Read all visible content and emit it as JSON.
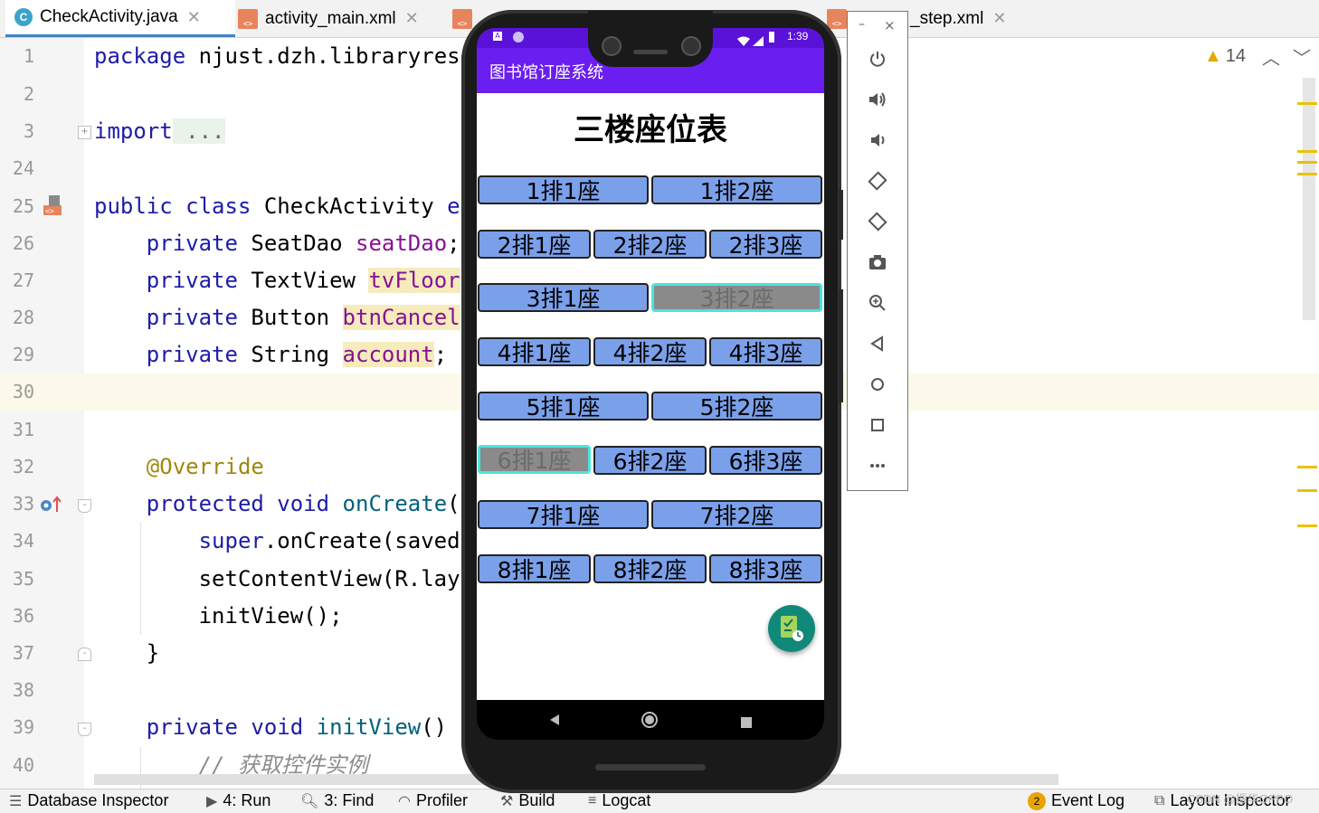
{
  "tabs": [
    {
      "label": "CheckActivity.java",
      "icon": "class-icon",
      "active": true
    },
    {
      "label": "activity_main.xml",
      "icon": "xml-icon",
      "active": false
    },
    {
      "label": "_step.xml",
      "icon": "xml-icon",
      "active": false
    }
  ],
  "editor": {
    "line_numbers": [
      "1",
      "2",
      "3",
      "24",
      "25",
      "26",
      "27",
      "28",
      "29",
      "30",
      "31",
      "32",
      "33",
      "34",
      "35",
      "36",
      "37",
      "38",
      "39",
      "40"
    ],
    "lines": {
      "l1_kw": "package",
      "l1_rest": " njust.dzh.libraryrese",
      "l3_kw": "import",
      "l3_rest": " ...",
      "l25_a": "public class",
      "l25_b": " CheckActivity ",
      "l25_c": "ex",
      "l26_a": "    private",
      "l26_b": " SeatDao ",
      "l26_c": "seatDao",
      "l26_d": ";",
      "l27_a": "    private",
      "l27_b": " TextView ",
      "l27_c": "tvFloor",
      "l27_d": ",",
      "l28_a": "    private",
      "l28_b": " Button ",
      "l28_c": "btnCancel",
      "l28_d": ";",
      "l29_a": "    private",
      "l29_b": " String ",
      "l29_c": "account",
      "l29_d": ";",
      "l32": "    @Override",
      "l33_a": "    protected void",
      "l33_b": " onCreate",
      "l33_c": "(B",
      "l34_a": "        super",
      "l34_b": ".onCreate(savedI",
      "l35": "        setContentView(R.layo",
      "l36": "        initView();",
      "l37": "    }",
      "l39_a": "    private void",
      "l39_b": " initView",
      "l39_c": "() {",
      "l40": "        // 获取控件实例"
    },
    "warning_count": "14"
  },
  "bottom_tools": {
    "database_inspector": "Database Inspector",
    "run": "4: Run",
    "find": "3: Find",
    "profiler": "Profiler",
    "build": "Build",
    "logcat": "Logcat",
    "event_log_badge": "2",
    "event_log": "Event Log",
    "layout_inspector": "Layout Inspector",
    "watermark": "CSDN @振华OPPO"
  },
  "emulator_controls": [
    "power-icon",
    "volume-up-icon",
    "volume-down-icon",
    "rotate-left-icon",
    "rotate-right-icon",
    "camera-icon",
    "zoom-icon",
    "back-icon",
    "home-icon",
    "overview-icon",
    "more-icon"
  ],
  "emulator_window": {
    "minimize": "–",
    "close": "×"
  },
  "phone": {
    "status_time": "1:39",
    "app_title": "图书馆订座系统",
    "page_title": "三楼座位表",
    "rows": [
      [
        "1排1座",
        "1排2座"
      ],
      [
        "2排1座",
        "2排2座",
        "2排3座"
      ],
      [
        "3排1座",
        "3排2座"
      ],
      [
        "4排1座",
        "4排2座",
        "4排3座"
      ],
      [
        "5排1座",
        "5排2座"
      ],
      [
        "6排1座",
        "6排2座",
        "6排3座"
      ],
      [
        "7排1座",
        "7排2座"
      ],
      [
        "8排1座",
        "8排2座",
        "8排3座"
      ]
    ],
    "taken_seats": [
      "3排2座",
      "6排1座"
    ],
    "colors": {
      "seat_free": "#7ba0ea",
      "seat_taken": "#8a8a8a",
      "taken_border": "#48e5df",
      "app_bar": "#6a1ef0",
      "fab": "#11897a"
    }
  }
}
